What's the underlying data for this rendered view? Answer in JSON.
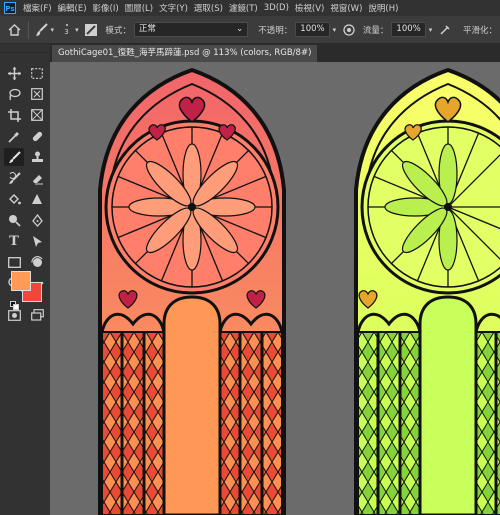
{
  "app": {
    "logo": "Ps"
  },
  "menu": [
    "檔案(F)",
    "編輯(E)",
    "影像(I)",
    "圖層(L)",
    "文字(Y)",
    "選取(S)",
    "濾鏡(T)",
    "3D(D)",
    "檢視(V)",
    "視窗(W)",
    "說明(H)"
  ],
  "options": {
    "brush_size": "3",
    "mode_label": "模式：",
    "mode_value": "正常",
    "opacity_label": "不透明：",
    "opacity_value": "100%",
    "flow_label": "流量：",
    "flow_value": "100%",
    "smoothing_label": "平滑化："
  },
  "document": {
    "tab_title": "GothiCage01_復甦_海芋馬蹄蓮.psd @ 113% (colors, RGB/8#)"
  },
  "colors": {
    "foreground": "#ff9a57",
    "background": "#f0473c",
    "canvas_bg": "#6b6b6b",
    "left_window_top": "#f2656a",
    "left_window_bottom": "#ffa45a",
    "right_window_top": "#fbff6a",
    "right_window_bottom": "#c6ff55",
    "lead": "#111111"
  },
  "tools": [
    "move-icon",
    "marquee-icon",
    "lasso-icon",
    "object-select-icon",
    "crop-icon",
    "frame-icon",
    "eyedropper-icon",
    "healing-icon",
    "brush-icon",
    "stamp-icon",
    "history-brush-icon",
    "eraser-icon",
    "paint-bucket-icon",
    "sharpen-icon",
    "dodge-icon",
    "pen-icon",
    "type-icon",
    "path-select-icon",
    "rectangle-icon",
    "rotate-view-icon",
    "zoom-icon",
    "more-tools-icon"
  ]
}
